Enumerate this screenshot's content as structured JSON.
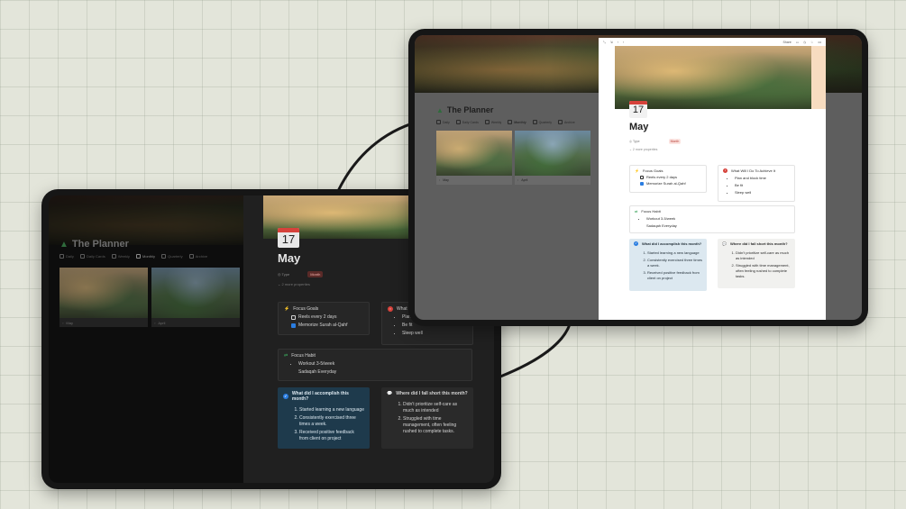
{
  "planner_title": "The Planner",
  "tabs": [
    {
      "label": "Daily"
    },
    {
      "label": "Daily Cards"
    },
    {
      "label": "Weekly"
    },
    {
      "label": "Monthly"
    },
    {
      "label": "Quarterly"
    },
    {
      "label": "Archive"
    }
  ],
  "gallery": [
    {
      "label": "May"
    },
    {
      "label": "April"
    }
  ],
  "page": {
    "day": "17",
    "title": "May",
    "type_label": "Type",
    "type_value": "Month",
    "more_properties": "2 more properties"
  },
  "focus_goals": {
    "heading": "Focus Goals",
    "items": [
      {
        "text": "Reels every 2 days",
        "checked": false
      },
      {
        "text": "Memorize Surah al-Qahf",
        "checked": true
      }
    ]
  },
  "achieve": {
    "heading": "What Will I Do To Achieve It",
    "heading_cut": "What W",
    "items": [
      "Plan and block time",
      "Be fit",
      "Sleep well"
    ],
    "items_cut": [
      "Plan",
      "Be fit",
      "Sleep well"
    ]
  },
  "focus_habit": {
    "heading": "Focus Habit",
    "items": [
      "Workout 3-5/week",
      "Sadaqah Everyday"
    ]
  },
  "accomplish": {
    "heading": "What did I accomplish this month?",
    "items": [
      "Started learning a new language",
      "Consistently exercised three times a week.",
      "Received positive feedback from client on project"
    ]
  },
  "fall_short": {
    "heading": "Where did I fall short this month?",
    "items": [
      "Didn't prioritize self-care as much as intended",
      "Struggled with time management, often feeling rushed to complete tasks."
    ]
  },
  "topbar": {
    "share": "Share"
  },
  "colors": {
    "accent_red": "#d6423b",
    "callout_blue_dark": "#1e3a4c",
    "callout_blue_light": "#dce8f0"
  }
}
